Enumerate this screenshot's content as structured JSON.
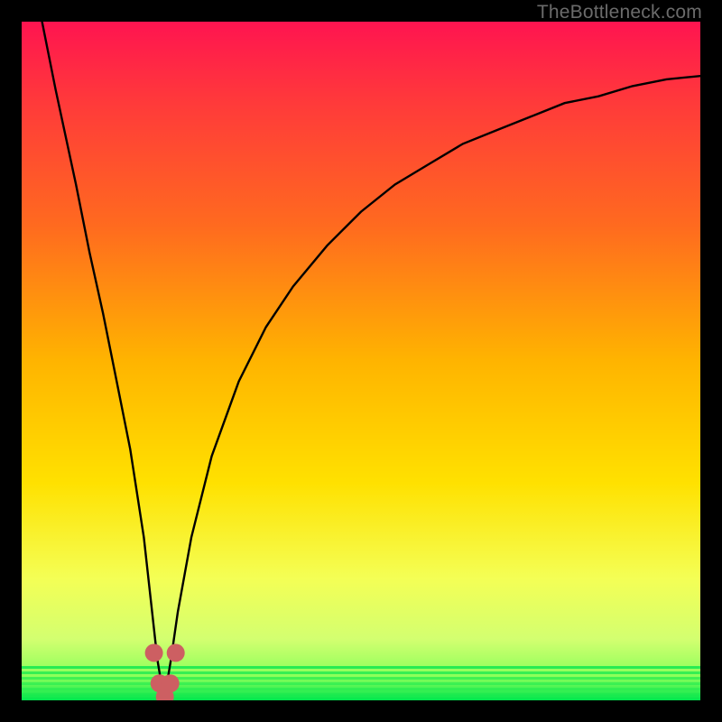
{
  "watermark": "TheBottleneck.com",
  "colors": {
    "frame_bg": "#000000",
    "curve": "#000000",
    "marker_fill": "#cd5f62",
    "green_band": "#00e64d",
    "gradient_stops": [
      {
        "pos": 0.0,
        "color": "#ff1450"
      },
      {
        "pos": 0.12,
        "color": "#ff3a3a"
      },
      {
        "pos": 0.3,
        "color": "#ff6a1f"
      },
      {
        "pos": 0.5,
        "color": "#ffb400"
      },
      {
        "pos": 0.68,
        "color": "#ffe100"
      },
      {
        "pos": 0.82,
        "color": "#f4ff55"
      },
      {
        "pos": 0.91,
        "color": "#d3ff70"
      },
      {
        "pos": 0.965,
        "color": "#8bff5a"
      },
      {
        "pos": 1.0,
        "color": "#00e64d"
      }
    ]
  },
  "chart_data": {
    "type": "line",
    "title": "",
    "xlabel": "",
    "ylabel": "",
    "xlim": [
      0,
      100
    ],
    "ylim": [
      0,
      100
    ],
    "grid": false,
    "legend": false,
    "note": "V-shaped bottleneck curve; x is a normalized pairing score, y is bottleneck percent. Minimum near x≈21 at y≈0.",
    "series": [
      {
        "name": "bottleneck-curve",
        "x": [
          3,
          5,
          8,
          10,
          12,
          14,
          16,
          18,
          19,
          20,
          21,
          22,
          23,
          25,
          28,
          32,
          36,
          40,
          45,
          50,
          55,
          60,
          65,
          70,
          75,
          80,
          85,
          90,
          95,
          100
        ],
        "values": [
          100,
          90,
          76,
          66,
          57,
          47,
          37,
          24,
          15,
          6,
          0,
          6,
          13,
          24,
          36,
          47,
          55,
          61,
          67,
          72,
          76,
          79,
          82,
          84,
          86,
          88,
          89,
          90.5,
          91.5,
          92
        ]
      }
    ],
    "markers": {
      "name": "optimal-zone",
      "x": [
        19.5,
        20.3,
        21.1,
        21.9,
        22.7
      ],
      "values": [
        7,
        2.5,
        0.5,
        2.5,
        7
      ]
    }
  }
}
